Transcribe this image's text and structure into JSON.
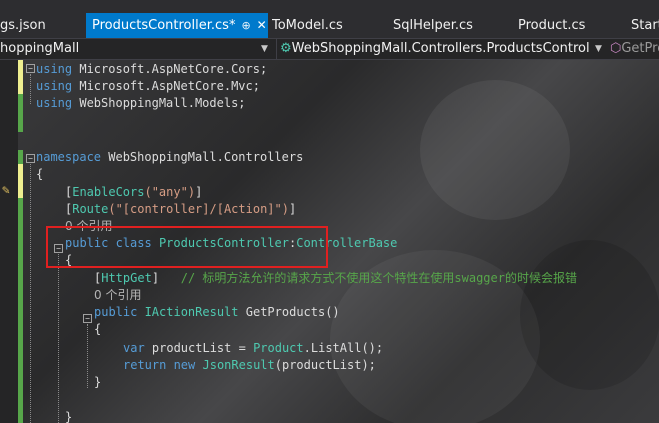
{
  "tabs": [
    {
      "label": "gs.json"
    },
    {
      "label": "ProductsController.cs*",
      "pin": "⊕",
      "close": "✕"
    },
    {
      "label": "ToModel.cs"
    },
    {
      "label": "SqlHelper.cs"
    },
    {
      "label": "Product.cs"
    },
    {
      "label": "Start"
    }
  ],
  "nav": {
    "project": "hoppingMall",
    "class": "WebShoppingMall.Controllers.ProductsController",
    "member": "GetPro"
  },
  "code": {
    "using1_kw": "using",
    "using1_ns": " Microsoft.AspNetCore.Cors;",
    "using2_kw": "using",
    "using2_ns": " Microsoft.AspNetCore.Mvc;",
    "using3_kw": "using",
    "using3_ns": " WebShoppingMall.Models;",
    "ns_kw": "namespace",
    "ns_name": " WebShoppingMall.Controllers",
    "brace_open": "{",
    "attr_cors_open": "[",
    "attr_cors_name": "EnableCors",
    "attr_cors_arg": "(\"any\")",
    "attr_cors_close": "]",
    "attr_route_open": "[",
    "attr_route_name": "Route",
    "attr_route_arg": "(\"[controller]/[Action]\")",
    "attr_route_close": "]",
    "refs1": "0 个引用",
    "class_kw1": "public",
    "class_kw2": " class",
    "class_name": " ProductsController",
    "class_colon": ":",
    "class_base": "ControllerBase",
    "class_brace": "{",
    "attr_get_open": "[",
    "attr_get_name": "HttpGet",
    "attr_get_close": "]",
    "comment": "// 标明方法允许的请求方式不使用这个特性在使用swagger的时候会报错",
    "refs2": "0 个引用",
    "method_kw": "public",
    "method_type": " IActionResult",
    "method_name": " GetProducts()",
    "method_brace": "{",
    "var_kw": "var",
    "var_name": " productList = ",
    "var_type": "Product",
    "var_call": ".ListAll();",
    "ret_kw": "return",
    "ret_new": " new",
    "ret_type": " JsonResult",
    "ret_arg": "(productList);",
    "method_close": "}",
    "class_close": "}"
  }
}
